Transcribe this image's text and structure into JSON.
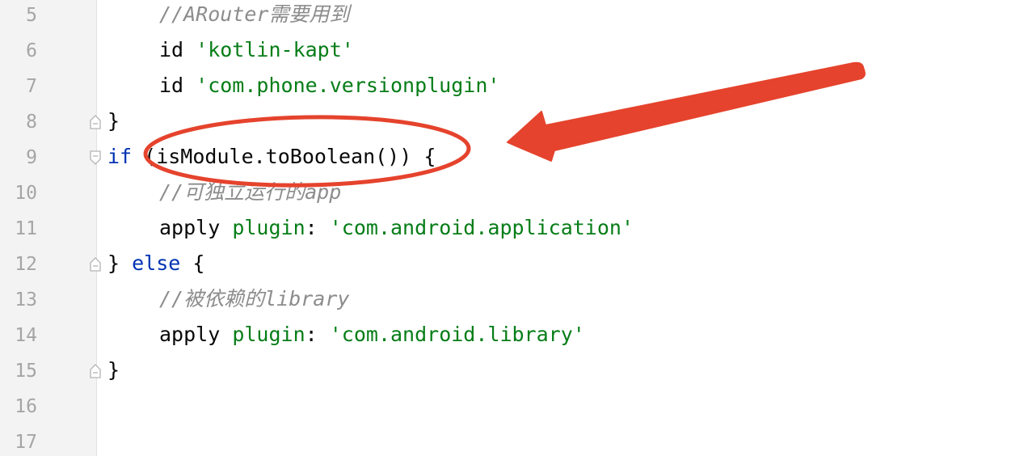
{
  "editor": {
    "lines": [
      {
        "number": "5",
        "indent": 1,
        "tokens": [
          {
            "text": "//ARouter需要用到",
            "kind": "comment"
          }
        ]
      },
      {
        "number": "6",
        "indent": 1,
        "tokens": [
          {
            "text": "id ",
            "kind": "ident"
          },
          {
            "text": "'kotlin-kapt'",
            "kind": "string"
          }
        ]
      },
      {
        "number": "7",
        "indent": 1,
        "tokens": [
          {
            "text": "id ",
            "kind": "ident"
          },
          {
            "text": "'com.phone.versionplugin'",
            "kind": "string"
          }
        ]
      },
      {
        "number": "8",
        "indent": 0,
        "fold": "end",
        "tokens": [
          {
            "text": "}",
            "kind": "ident"
          }
        ]
      },
      {
        "number": "9",
        "indent": 0,
        "fold": "start",
        "tokens": [
          {
            "text": "if ",
            "kind": "keyword"
          },
          {
            "text": "(isModule.toBoolean()) {",
            "kind": "ident"
          }
        ]
      },
      {
        "number": "10",
        "indent": 1,
        "tokens": [
          {
            "text": "//可独立运行的app",
            "kind": "comment"
          }
        ]
      },
      {
        "number": "11",
        "indent": 1,
        "tokens": [
          {
            "text": "apply ",
            "kind": "ident"
          },
          {
            "text": "plugin",
            "kind": "plugin"
          },
          {
            "text": ": ",
            "kind": "ident"
          },
          {
            "text": "'com.android.application'",
            "kind": "string"
          }
        ]
      },
      {
        "number": "12",
        "indent": 0,
        "fold": "middle",
        "tokens": [
          {
            "text": "} ",
            "kind": "ident"
          },
          {
            "text": "else",
            "kind": "keyword"
          },
          {
            "text": " {",
            "kind": "ident"
          }
        ]
      },
      {
        "number": "13",
        "indent": 1,
        "tokens": [
          {
            "text": "//被依赖的library",
            "kind": "comment"
          }
        ]
      },
      {
        "number": "14",
        "indent": 1,
        "tokens": [
          {
            "text": "apply ",
            "kind": "ident"
          },
          {
            "text": "plugin",
            "kind": "plugin"
          },
          {
            "text": ": ",
            "kind": "ident"
          },
          {
            "text": "'com.android.library'",
            "kind": "string"
          }
        ]
      },
      {
        "number": "15",
        "indent": 0,
        "fold": "end",
        "tokens": [
          {
            "text": "}",
            "kind": "ident"
          }
        ]
      },
      {
        "number": "16",
        "indent": 0,
        "tokens": []
      },
      {
        "number": "17",
        "indent": 0,
        "tokens": []
      }
    ]
  },
  "annotation": {
    "color": "#e5432d",
    "highlight_shape": "ellipse",
    "pointer_shape": "arrow"
  },
  "colors": {
    "comment": "#8c8c8c",
    "keyword": "#0033b3",
    "string": "#067d17",
    "identifier": "#080808",
    "gutter_bg": "#f3f3f3",
    "line_number": "#a5a5a5"
  }
}
